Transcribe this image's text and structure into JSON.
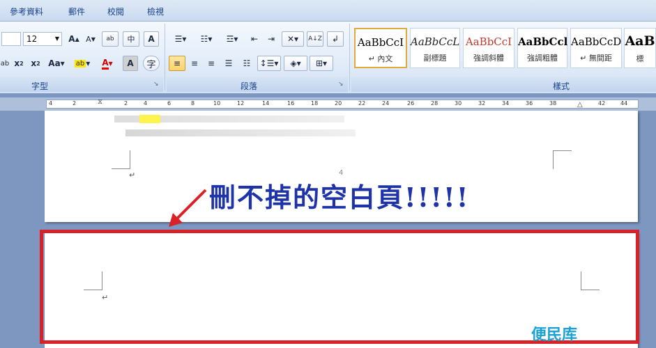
{
  "menu_tabs": [
    "參考資料",
    "郵件",
    "校閱",
    "檢視"
  ],
  "font_group": {
    "size": "12",
    "label": "字型"
  },
  "paragraph_group": {
    "label": "段落"
  },
  "styles_group": {
    "label": "樣式",
    "styles": [
      {
        "sample": "AaBbCcI",
        "name": "↵ 內文",
        "color": "#000000",
        "italic": false,
        "bold": false
      },
      {
        "sample": "AaBbCcL",
        "name": "副標題",
        "color": "#1f1f1f",
        "italic": true,
        "bold": false
      },
      {
        "sample": "AaBbCcI",
        "name": "強調斜體",
        "color": "#c0392b",
        "italic": false,
        "bold": false
      },
      {
        "sample": "AaBbCcl",
        "name": "強調粗體",
        "color": "#000000",
        "italic": false,
        "bold": true
      },
      {
        "sample": "AaBbCcD",
        "name": "↵ 無間距",
        "color": "#000000",
        "italic": false,
        "bold": false
      },
      {
        "sample": "AaB",
        "name": "標",
        "color": "#000000",
        "italic": false,
        "bold": true
      }
    ]
  },
  "ruler_ticks": [
    "4",
    "2",
    "2",
    "4",
    "6",
    "8",
    "10",
    "12",
    "14",
    "16",
    "18",
    "20",
    "22",
    "24",
    "26",
    "28",
    "30",
    "32",
    "34",
    "36",
    "38",
    "42",
    "44"
  ],
  "document": {
    "page_number": "4",
    "pilcrow": "↵"
  },
  "annotation": {
    "caption": "刪不掉的空白頁!!!!!",
    "highlight_color": "#d92128",
    "caption_color": "#1f33a8"
  },
  "watermark": "便民库",
  "colors": {
    "ribbon_text": "#15428b",
    "background": "#7d97c1"
  }
}
